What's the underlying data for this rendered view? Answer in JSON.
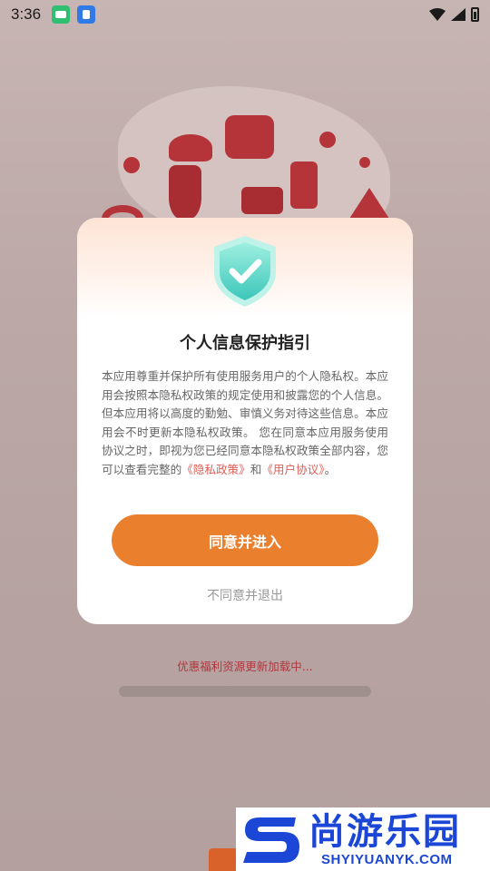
{
  "status_bar": {
    "time": "3:36",
    "icons": [
      "app-green-icon",
      "app-blue-icon",
      "wifi-icon",
      "signal-icon",
      "battery-icon"
    ]
  },
  "dialog": {
    "title": "个人信息保护指引",
    "body_text": "本应用尊重并保护所有使用服务用户的个人隐私权。本应用会按照本隐私权政策的规定使用和披露您的个人信息。但本应用将以高度的勤勉、审慎义务对待这些信息。本应用会不时更新本隐私权政策。 您在同意本应用服务使用协议之时，即视为您已经同意本隐私权政策全部内容，您可以查看完整的",
    "privacy_link": "《隐私政策》",
    "conjunction": "和",
    "user_agreement_link": "《用户协议》",
    "end_punctuation": "。",
    "agree_button": "同意并进入",
    "disagree_link": "不同意并退出"
  },
  "loading": {
    "text": "优惠福利资源更新加载中..."
  },
  "watermark": {
    "cn": "尚游乐园",
    "en": "SHYIYUANYK.COM"
  },
  "colors": {
    "accent": "#ea7f2d",
    "link": "#e25d55",
    "loading_text": "#b0363e",
    "watermark_blue": "#1c47d6"
  }
}
